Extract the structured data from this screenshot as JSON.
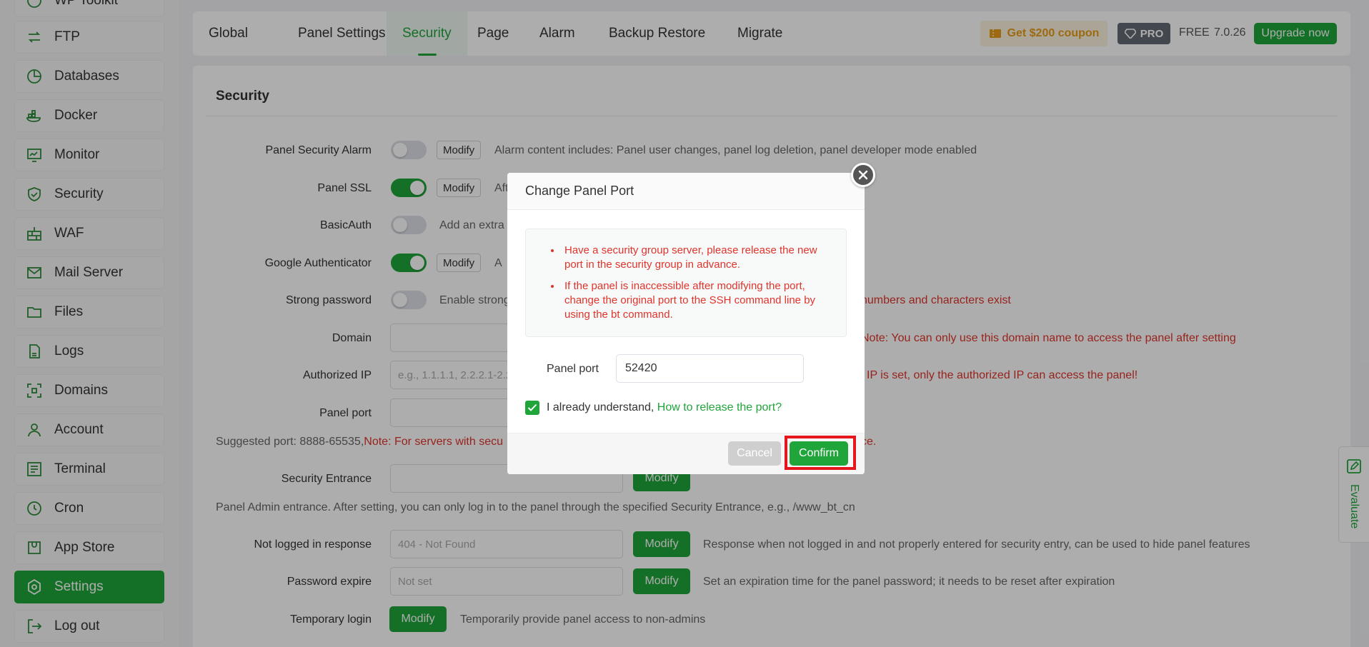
{
  "sidebar": {
    "items": [
      {
        "label": "WP Toolkit",
        "icon": "wordpress-icon"
      },
      {
        "label": "FTP",
        "icon": "ftp-icon"
      },
      {
        "label": "Databases",
        "icon": "database-icon"
      },
      {
        "label": "Docker",
        "icon": "docker-icon"
      },
      {
        "label": "Monitor",
        "icon": "monitor-icon"
      },
      {
        "label": "Security",
        "icon": "shield-icon"
      },
      {
        "label": "WAF",
        "icon": "firewall-icon"
      },
      {
        "label": "Mail Server",
        "icon": "mail-icon"
      },
      {
        "label": "Files",
        "icon": "folder-icon"
      },
      {
        "label": "Logs",
        "icon": "log-icon"
      },
      {
        "label": "Domains",
        "icon": "domain-icon"
      },
      {
        "label": "Account",
        "icon": "user-icon"
      },
      {
        "label": "Terminal",
        "icon": "terminal-icon"
      },
      {
        "label": "Cron",
        "icon": "clock-icon"
      },
      {
        "label": "App Store",
        "icon": "store-icon"
      },
      {
        "label": "Settings",
        "icon": "settings-icon"
      },
      {
        "label": "Log out",
        "icon": "logout-icon"
      }
    ]
  },
  "tabs": [
    "Global",
    "Panel Settings",
    "Security",
    "Page",
    "Alarm",
    "Backup Restore",
    "Migrate"
  ],
  "active_tab": "Security",
  "header": {
    "coupon": "Get $200 coupon",
    "pro": "PRO",
    "free": "FREE",
    "version": "7.0.26",
    "upgrade": "Upgrade now"
  },
  "section": {
    "title": "Security"
  },
  "rows": {
    "alarm": {
      "label": "Panel Security Alarm",
      "modify": "Modify",
      "desc": "Alarm content includes: Panel user changes, panel log deletion, panel developer mode enabled"
    },
    "ssl": {
      "label": "Panel SSL",
      "modify": "Modify",
      "desc": "Aft"
    },
    "basicauth": {
      "label": "BasicAuth",
      "desc": "Add an extra"
    },
    "google": {
      "label": "Google Authenticator",
      "modify": "Modify",
      "desc": "A"
    },
    "strong": {
      "label": "Strong password",
      "desc": "Enable strong",
      "desc_tail": "numbers and characters exist"
    },
    "domain": {
      "label": "Domain",
      "note": "Note: You can only use this domain name to access the panel after setting"
    },
    "authip": {
      "label": "Authorized IP",
      "placeholder": "e.g., 1.1.1.1, 2.2.2.1-2.2.",
      "note": "IP is set, only the authorized IP can access the panel!"
    },
    "port": {
      "label": "Panel port",
      "suggest": "Suggested port: 8888-65535,",
      "suggest_note": "Note: For servers with secu",
      "suggest_tail": "ce."
    },
    "entrance": {
      "label": "Security Entrance",
      "modify": "Modify",
      "desc": "Panel Admin entrance. After setting, you can only log in to the panel through the specified Security Entrance, e.g., /www_bt_cn"
    },
    "notlogged": {
      "label": "Not logged in response",
      "value": "404 - Not Found",
      "modify": "Modify",
      "desc": "Response when not logged in and not properly entered for security entry, can be used to hide panel features"
    },
    "pwexpire": {
      "label": "Password expire",
      "value": "Not set",
      "modify": "Modify",
      "desc": "Set an expiration time for the panel password; it needs to be reset after expiration"
    },
    "templogin": {
      "label": "Temporary login",
      "modify": "Modify",
      "desc": "Temporarily provide panel access to non-admins"
    }
  },
  "evaluate": "Evaluate",
  "dialog": {
    "title": "Change Panel Port",
    "warnings": [
      "Have a security group server, please release the new port in the security group in advance.",
      "If the panel is inaccessible after modifying the port, change the original port to the SSH command line by using the bt command."
    ],
    "port_label": "Panel port",
    "port_value": "52420",
    "checkbox_text": "I already understand,",
    "checkbox_link": "How to release the port?",
    "checked": true,
    "cancel": "Cancel",
    "confirm": "Confirm"
  },
  "colors": {
    "accent": "#20a53a",
    "warning": "#e0342b",
    "highlight": "#e5161c"
  }
}
